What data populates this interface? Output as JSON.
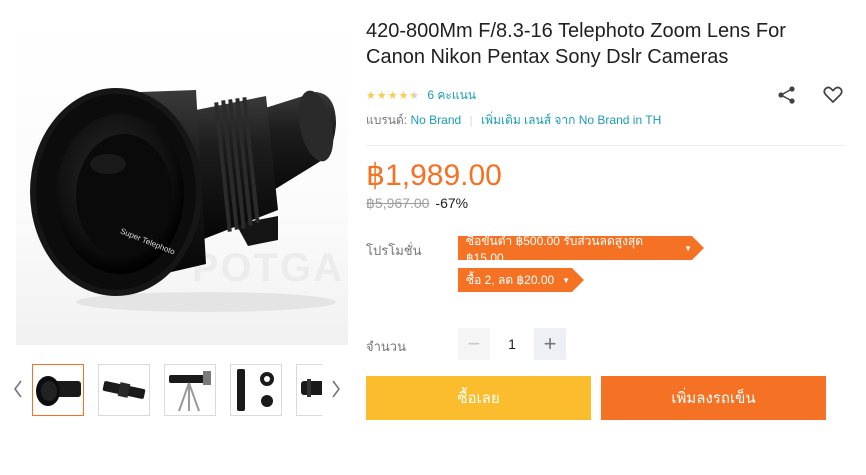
{
  "product": {
    "title_line1": "420-800Mm F/8.3-16 Telephoto Zoom Lens For",
    "title_line2": "Canon Nikon Pentax Sony Dslr Cameras",
    "rating_stars": 4.5,
    "rating_count_text": "6 คะแนน",
    "brand_label": "แบรนด์:",
    "brand_name": "No Brand",
    "brand_more": "เพิ่มเติม เลนส์ จาก No Brand in TH",
    "watermark_text": "POTGA"
  },
  "price": {
    "current": "฿1,989.00",
    "original": "฿5,967.00",
    "discount": "-67%"
  },
  "promotion": {
    "label": "โปรโมชั่น",
    "tags": [
      "ซื้อขั้นต่ำ ฿500.00 รับส่วนลดสูงสุด ฿15.00",
      "ซื้อ 2, ลด ฿20.00"
    ]
  },
  "quantity": {
    "label": "จำนวน",
    "value": "1",
    "minus": "−",
    "plus": "+"
  },
  "actions": {
    "buy_now": "ซื้อเลย",
    "add_to_cart": "เพิ่มลงรถเข็น"
  },
  "icons": {
    "share": "share-icon",
    "wishlist": "heart-icon",
    "prev": "chevron-left-icon",
    "next": "chevron-right-icon"
  },
  "lens_text": "Super Telephoto",
  "colors": {
    "accent": "#f57224",
    "buy_now": "#fbbd2d",
    "link": "#1a9cb7",
    "star": "#faca51"
  },
  "thumbnails": [
    {
      "name": "thumbnail-lens-front",
      "active": true
    },
    {
      "name": "thumbnail-lens-side",
      "active": false
    },
    {
      "name": "thumbnail-lens-tripod",
      "active": false
    },
    {
      "name": "thumbnail-lens-parts",
      "active": false
    },
    {
      "name": "thumbnail-lens-partial",
      "active": false
    }
  ]
}
